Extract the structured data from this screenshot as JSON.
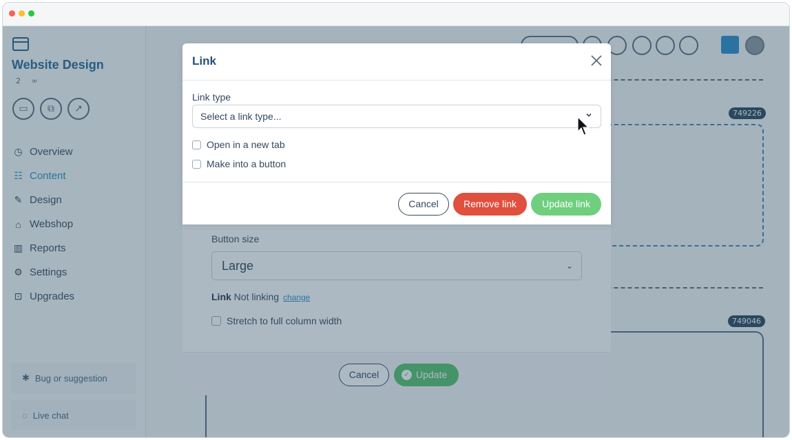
{
  "app": {
    "site_title": "Website Design",
    "site_meta_count": "2",
    "nav": [
      {
        "label": "Overview",
        "icon": "overview-icon"
      },
      {
        "label": "Content",
        "icon": "content-icon",
        "active": true
      },
      {
        "label": "Design",
        "icon": "design-icon"
      },
      {
        "label": "Webshop",
        "icon": "basket-icon"
      },
      {
        "label": "Reports",
        "icon": "chart-icon"
      },
      {
        "label": "Settings",
        "icon": "gear-icon"
      },
      {
        "label": "Upgrades",
        "icon": "upgrades-icon"
      }
    ],
    "bug_button": "Bug or suggestion",
    "live_chat": "Live chat",
    "block_ids": [
      "749226",
      "749046"
    ]
  },
  "button_dialog": {
    "size_label": "Button size",
    "size_value": "Large",
    "link_label": "Link",
    "link_value": "Not linking",
    "link_change": "change",
    "stretch_label": "Stretch to full column width",
    "cancel": "Cancel",
    "update": "Update"
  },
  "link_dialog": {
    "title": "Link",
    "link_type_label": "Link type",
    "link_type_placeholder": "Select a link type...",
    "open_new_tab": "Open in a new tab",
    "make_button": "Make into a button",
    "cancel": "Cancel",
    "remove": "Remove link",
    "update": "Update link"
  },
  "colors": {
    "accent": "#24527a",
    "remove": "#e0503f",
    "update": "#6fcf7f"
  }
}
